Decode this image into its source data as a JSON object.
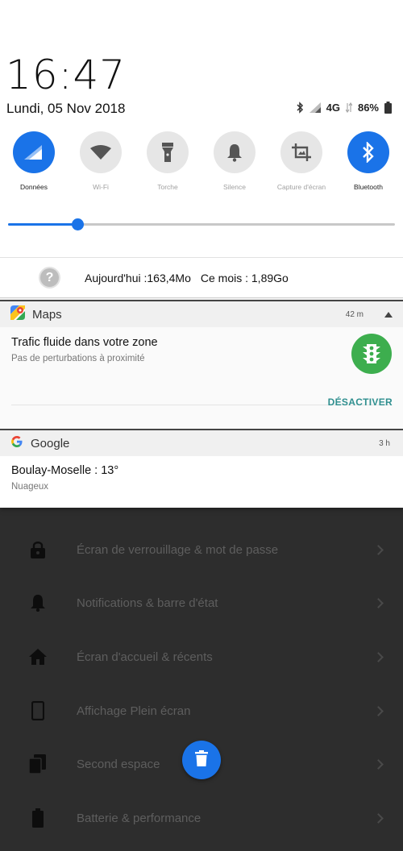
{
  "clock": {
    "time": "16:47",
    "date": "Lundi, 05 Nov 2018"
  },
  "status_bar": {
    "network": "4G",
    "battery": "86%"
  },
  "quick_toggles": [
    {
      "label": "Données",
      "icon": "mobile-data-icon",
      "active": true
    },
    {
      "label": "Wi-Fi",
      "icon": "wifi-icon",
      "active": false
    },
    {
      "label": "Torche",
      "icon": "flashlight-icon",
      "active": false
    },
    {
      "label": "Silence",
      "icon": "bell-icon",
      "active": false
    },
    {
      "label": "Capture d'écran",
      "icon": "screenshot-icon",
      "active": false
    },
    {
      "label": "Bluetooth",
      "icon": "bluetooth-icon",
      "active": true
    }
  ],
  "brightness": {
    "level": 0.18
  },
  "data_usage": {
    "today": "Aujourd'hui :163,4Mo",
    "month": "Ce mois : 1,89Go"
  },
  "notifications": {
    "maps": {
      "app": "Maps",
      "time": "42 m",
      "title": "Trafic fluide dans votre zone",
      "subtitle": "Pas de perturbations à proximité",
      "action": "DÉSACTIVER"
    },
    "google": {
      "app": "Google",
      "time": "3 h",
      "title": "Boulay-Moselle : 13°",
      "subtitle": "Nuageux"
    }
  },
  "settings_items": [
    {
      "label": "Écran de verrouillage & mot de passe",
      "icon": "lock-icon"
    },
    {
      "label": "Notifications & barre d'état",
      "icon": "bell-icon"
    },
    {
      "label": "Écran d'accueil & récents",
      "icon": "home-icon"
    },
    {
      "label": "Affichage Plein écran",
      "icon": "phone-icon"
    },
    {
      "label": "Second espace",
      "icon": "copy-icon"
    },
    {
      "label": "Batterie & performance",
      "icon": "battery-icon"
    }
  ],
  "colors": {
    "accent": "#1a73e8",
    "traffic_green": "#3dae4e",
    "action_teal": "#2f8f8f"
  }
}
